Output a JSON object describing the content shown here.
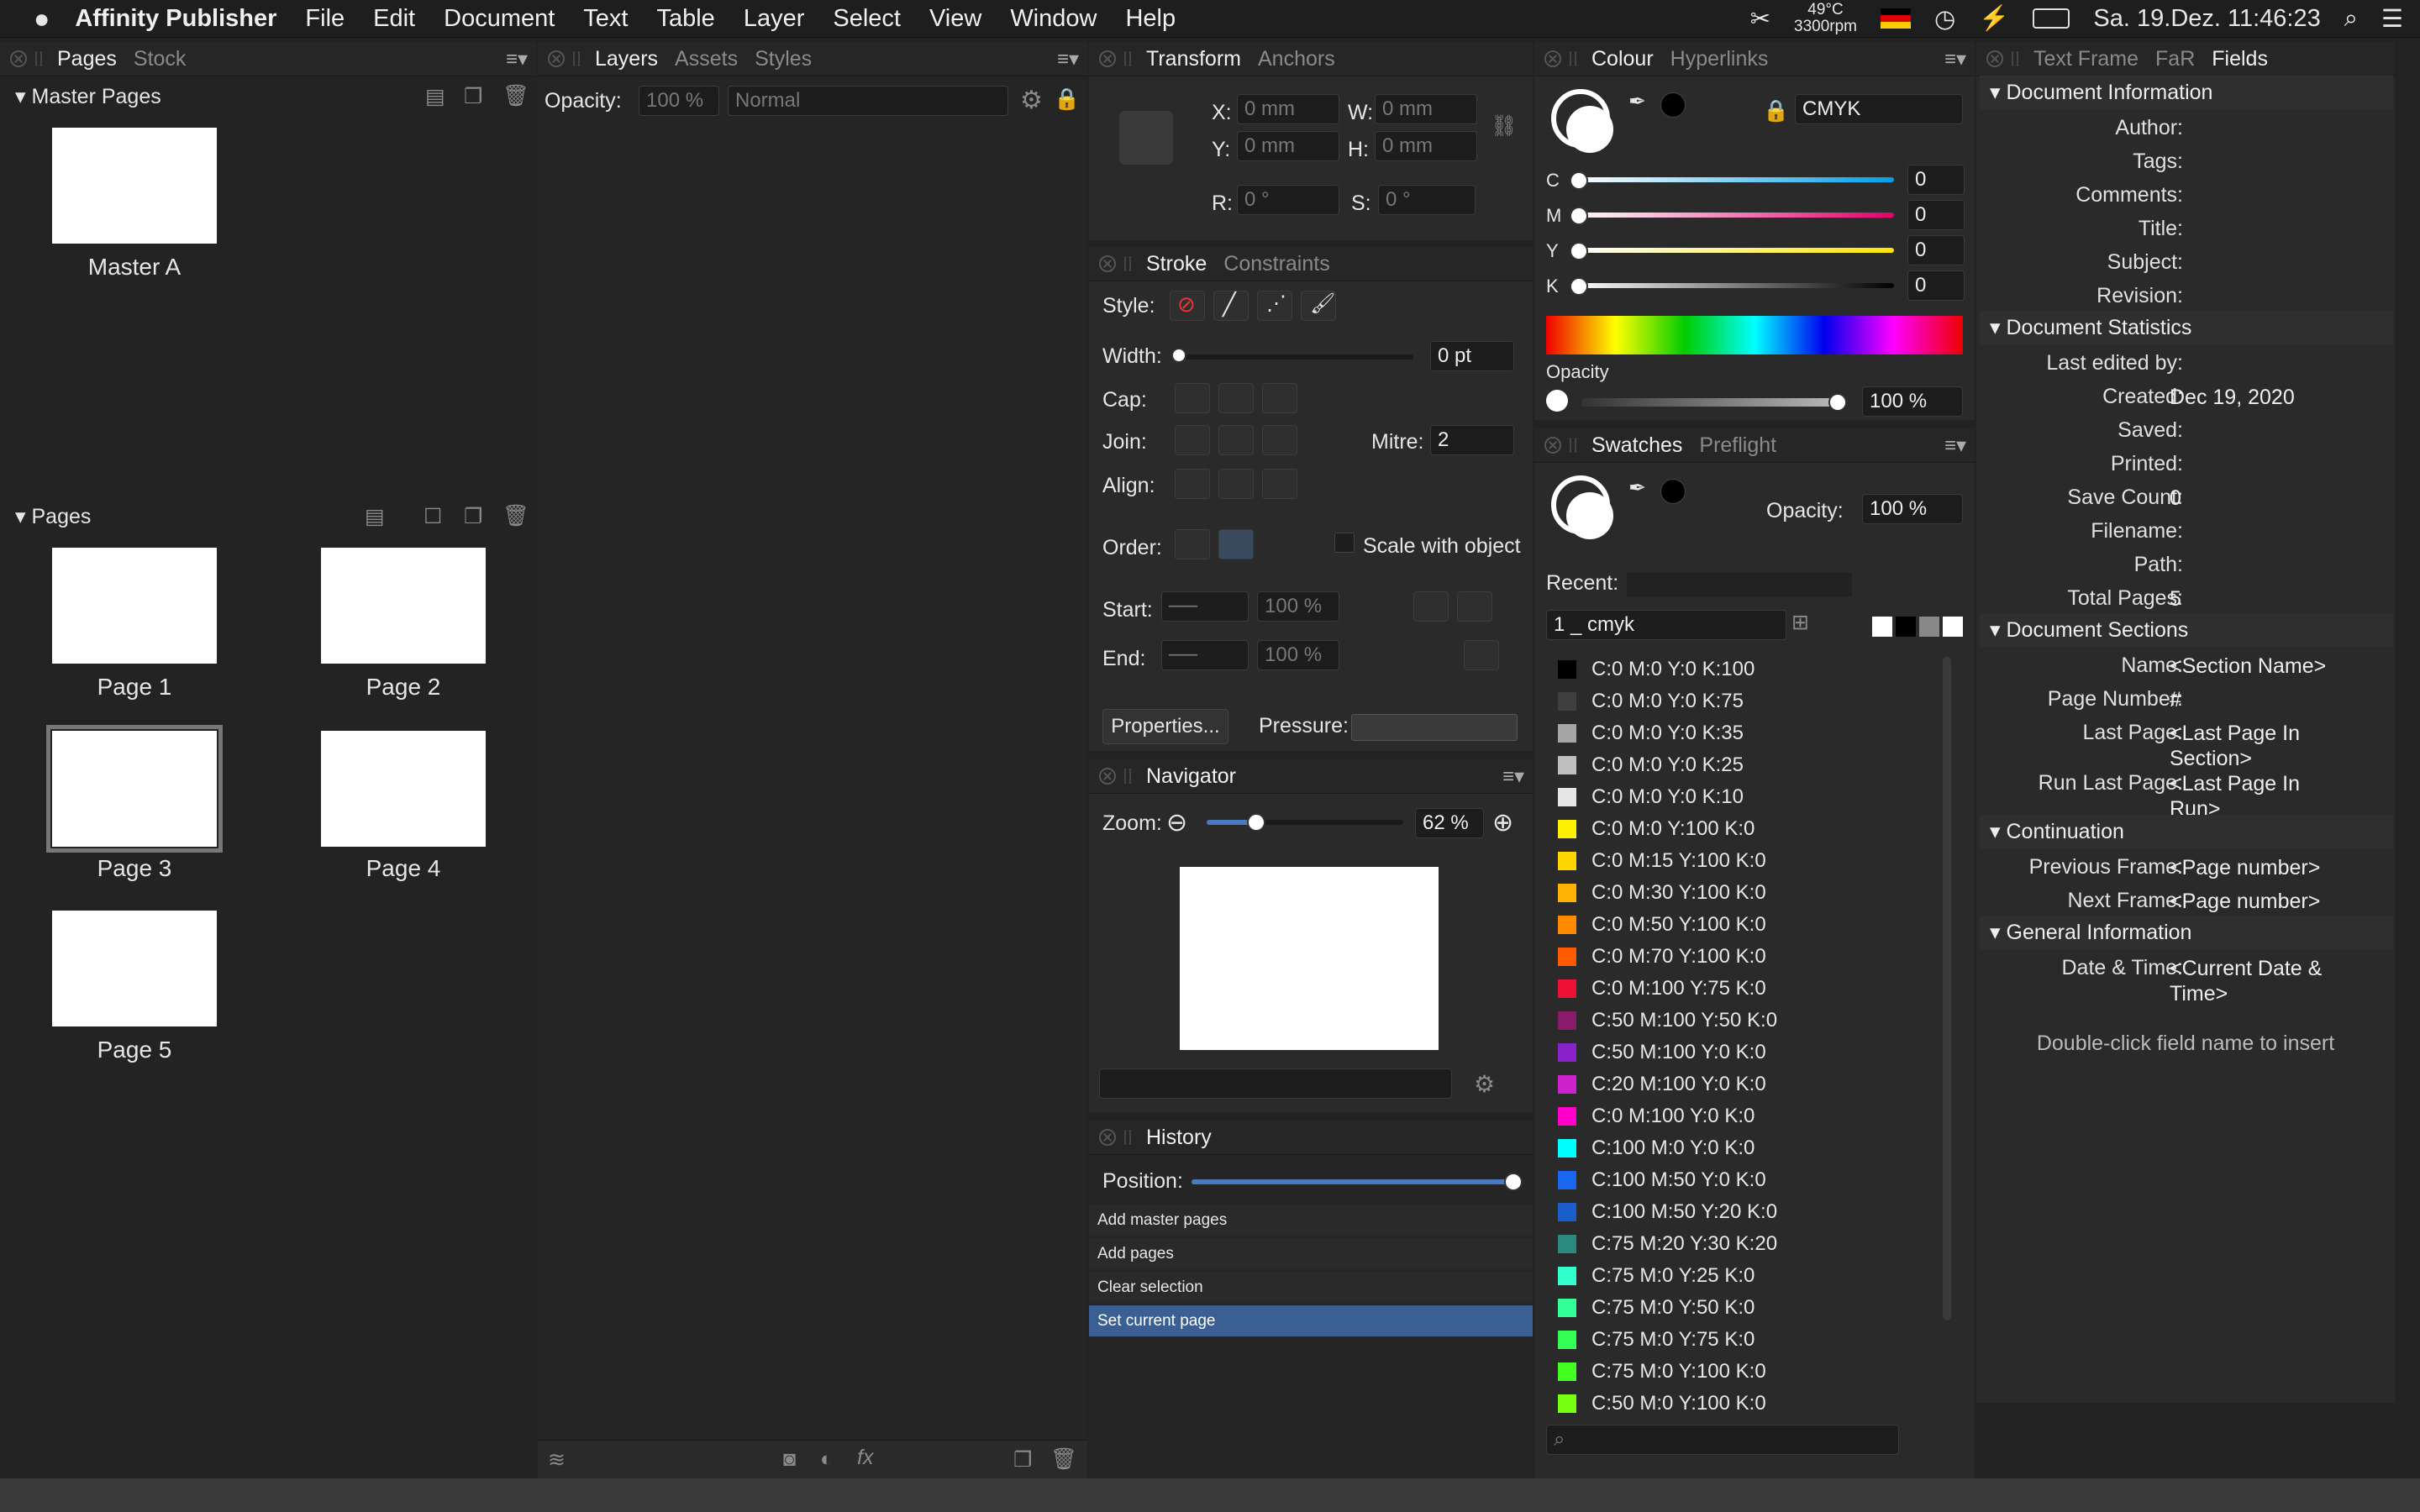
{
  "menubar": {
    "app": "Affinity Publisher",
    "items": [
      "File",
      "Edit",
      "Document",
      "Text",
      "Table",
      "Layer",
      "Select",
      "View",
      "Window",
      "Help"
    ],
    "temp": "49°C",
    "rpm": "3300rpm",
    "clock": "Sa. 19.Dez. 11:46:23"
  },
  "pages_panel": {
    "tabs": [
      "Pages",
      "Stock"
    ],
    "master_header": "Master Pages",
    "masters": [
      "Master A"
    ],
    "pages_header": "Pages",
    "pages": [
      "Page 1",
      "Page 2",
      "Page 3",
      "Page 4",
      "Page 5"
    ]
  },
  "layers_panel": {
    "tabs": [
      "Layers",
      "Assets",
      "Styles"
    ],
    "opacity_label": "Opacity:",
    "opacity_value": "100 %",
    "blend_mode": "Normal"
  },
  "transform_panel": {
    "tabs": [
      "Transform",
      "Anchors"
    ],
    "x_label": "X:",
    "x_value": "0 mm",
    "y_label": "Y:",
    "y_value": "0 mm",
    "w_label": "W:",
    "w_value": "0 mm",
    "h_label": "H:",
    "h_value": "0 mm",
    "r_label": "R:",
    "r_value": "0 °",
    "s_label": "S:",
    "s_value": "0 °"
  },
  "stroke_panel": {
    "tabs": [
      "Stroke",
      "Constraints"
    ],
    "style_label": "Style:",
    "width_label": "Width:",
    "width_value": "0 pt",
    "cap_label": "Cap:",
    "join_label": "Join:",
    "mitre_label": "Mitre:",
    "mitre_value": "2",
    "align_label": "Align:",
    "order_label": "Order:",
    "scale_label": "Scale with object",
    "start_label": "Start:",
    "start_pct": "100 %",
    "end_label": "End:",
    "end_pct": "100 %",
    "properties_button": "Properties...",
    "pressure_label": "Pressure:"
  },
  "navigator_panel": {
    "title": "Navigator",
    "zoom_label": "Zoom:",
    "zoom_value": "62 %"
  },
  "history_panel": {
    "title": "History",
    "position_label": "Position:",
    "items": [
      "Add master pages",
      "Add pages",
      "Clear selection",
      "Set current page"
    ]
  },
  "colour_panel": {
    "tabs": [
      "Colour",
      "Hyperlinks"
    ],
    "model": "CMYK",
    "channels": [
      {
        "name": "C",
        "value": "0"
      },
      {
        "name": "M",
        "value": "0"
      },
      {
        "name": "Y",
        "value": "0"
      },
      {
        "name": "K",
        "value": "0"
      }
    ],
    "opacity_label": "Opacity",
    "opacity_value": "100 %"
  },
  "swatches_panel": {
    "tabs": [
      "Swatches",
      "Preflight"
    ],
    "opacity_label": "Opacity:",
    "opacity_value": "100 %",
    "recent_label": "Recent:",
    "palette": "1 _ cmyk",
    "swatches": [
      {
        "name": "C:0 M:0 Y:0 K:100",
        "color": "#000000"
      },
      {
        "name": "C:0 M:0 Y:0 K:75",
        "color": "#3f3f3f"
      },
      {
        "name": "C:0 M:0 Y:0 K:35",
        "color": "#a6a6a6"
      },
      {
        "name": "C:0 M:0 Y:0 K:25",
        "color": "#bfbfbf"
      },
      {
        "name": "C:0 M:0 Y:0 K:10",
        "color": "#e6e6e6"
      },
      {
        "name": "C:0 M:0 Y:100 K:0",
        "color": "#fff200"
      },
      {
        "name": "C:0 M:15 Y:100 K:0",
        "color": "#ffd500"
      },
      {
        "name": "C:0 M:30 Y:100 K:0",
        "color": "#ffb300"
      },
      {
        "name": "C:0 M:50 Y:100 K:0",
        "color": "#ff8a00"
      },
      {
        "name": "C:0 M:70 Y:100 K:0",
        "color": "#ff5a00"
      },
      {
        "name": "C:0 M:100 Y:75 K:0",
        "color": "#ee1133"
      },
      {
        "name": "C:50 M:100 Y:50 K:0",
        "color": "#8a1a6a"
      },
      {
        "name": "C:50 M:100 Y:0 K:0",
        "color": "#8a22cc"
      },
      {
        "name": "C:20 M:100 Y:0 K:0",
        "color": "#cc22cc"
      },
      {
        "name": "C:0 M:100 Y:0 K:0",
        "color": "#ff00cc"
      },
      {
        "name": "C:100 M:0 Y:0 K:0",
        "color": "#00ffff"
      },
      {
        "name": "C:100 M:50 Y:0 K:0",
        "color": "#1a66ee"
      },
      {
        "name": "C:100 M:50 Y:20 K:0",
        "color": "#1a5ecc"
      },
      {
        "name": "C:75 M:20 Y:30 K:20",
        "color": "#2a8a80"
      },
      {
        "name": "C:75 M:0 Y:25 K:0",
        "color": "#33ffcc"
      },
      {
        "name": "C:75 M:0 Y:50 K:0",
        "color": "#33ff99"
      },
      {
        "name": "C:75 M:0 Y:75 K:0",
        "color": "#33ff55"
      },
      {
        "name": "C:75 M:0 Y:100 K:0",
        "color": "#44ff22"
      },
      {
        "name": "C:50 M:0 Y:100 K:0",
        "color": "#77ff11"
      }
    ]
  },
  "fields_panel": {
    "tabs": [
      "Text Frame",
      "FaR",
      "Fields"
    ],
    "sections": [
      {
        "title": "Document Information",
        "rows": [
          {
            "label": "Author:",
            "value": ""
          },
          {
            "label": "Tags:",
            "value": ""
          },
          {
            "label": "Comments:",
            "value": ""
          },
          {
            "label": "Title:",
            "value": ""
          },
          {
            "label": "Subject:",
            "value": ""
          },
          {
            "label": "Revision:",
            "value": ""
          }
        ]
      },
      {
        "title": "Document Statistics",
        "rows": [
          {
            "label": "Last edited by:",
            "value": ""
          },
          {
            "label": "Created:",
            "value": "Dec 19, 2020"
          },
          {
            "label": "Saved:",
            "value": ""
          },
          {
            "label": "Printed:",
            "value": ""
          },
          {
            "label": "Save Count:",
            "value": "0"
          },
          {
            "label": "Filename:",
            "value": ""
          },
          {
            "label": "Path:",
            "value": ""
          },
          {
            "label": "Total Pages:",
            "value": "5"
          }
        ]
      },
      {
        "title": "Document Sections",
        "rows": [
          {
            "label": "Name:",
            "value": "<Section Name>"
          },
          {
            "label": "Page Number:",
            "value": "#"
          },
          {
            "label": "Last Page:",
            "value": "<Last Page In Section>"
          },
          {
            "label": "Run Last Page:",
            "value": "<Last Page In Run>"
          }
        ]
      },
      {
        "title": "Continuation",
        "rows": [
          {
            "label": "Previous Frame:",
            "value": "<Page number>"
          },
          {
            "label": "Next Frame:",
            "value": "<Page number>"
          }
        ]
      },
      {
        "title": "General Information",
        "rows": [
          {
            "label": "Date & Time:",
            "value": "<Current Date & Time>"
          }
        ]
      }
    ],
    "hint": "Double-click field name to insert"
  }
}
